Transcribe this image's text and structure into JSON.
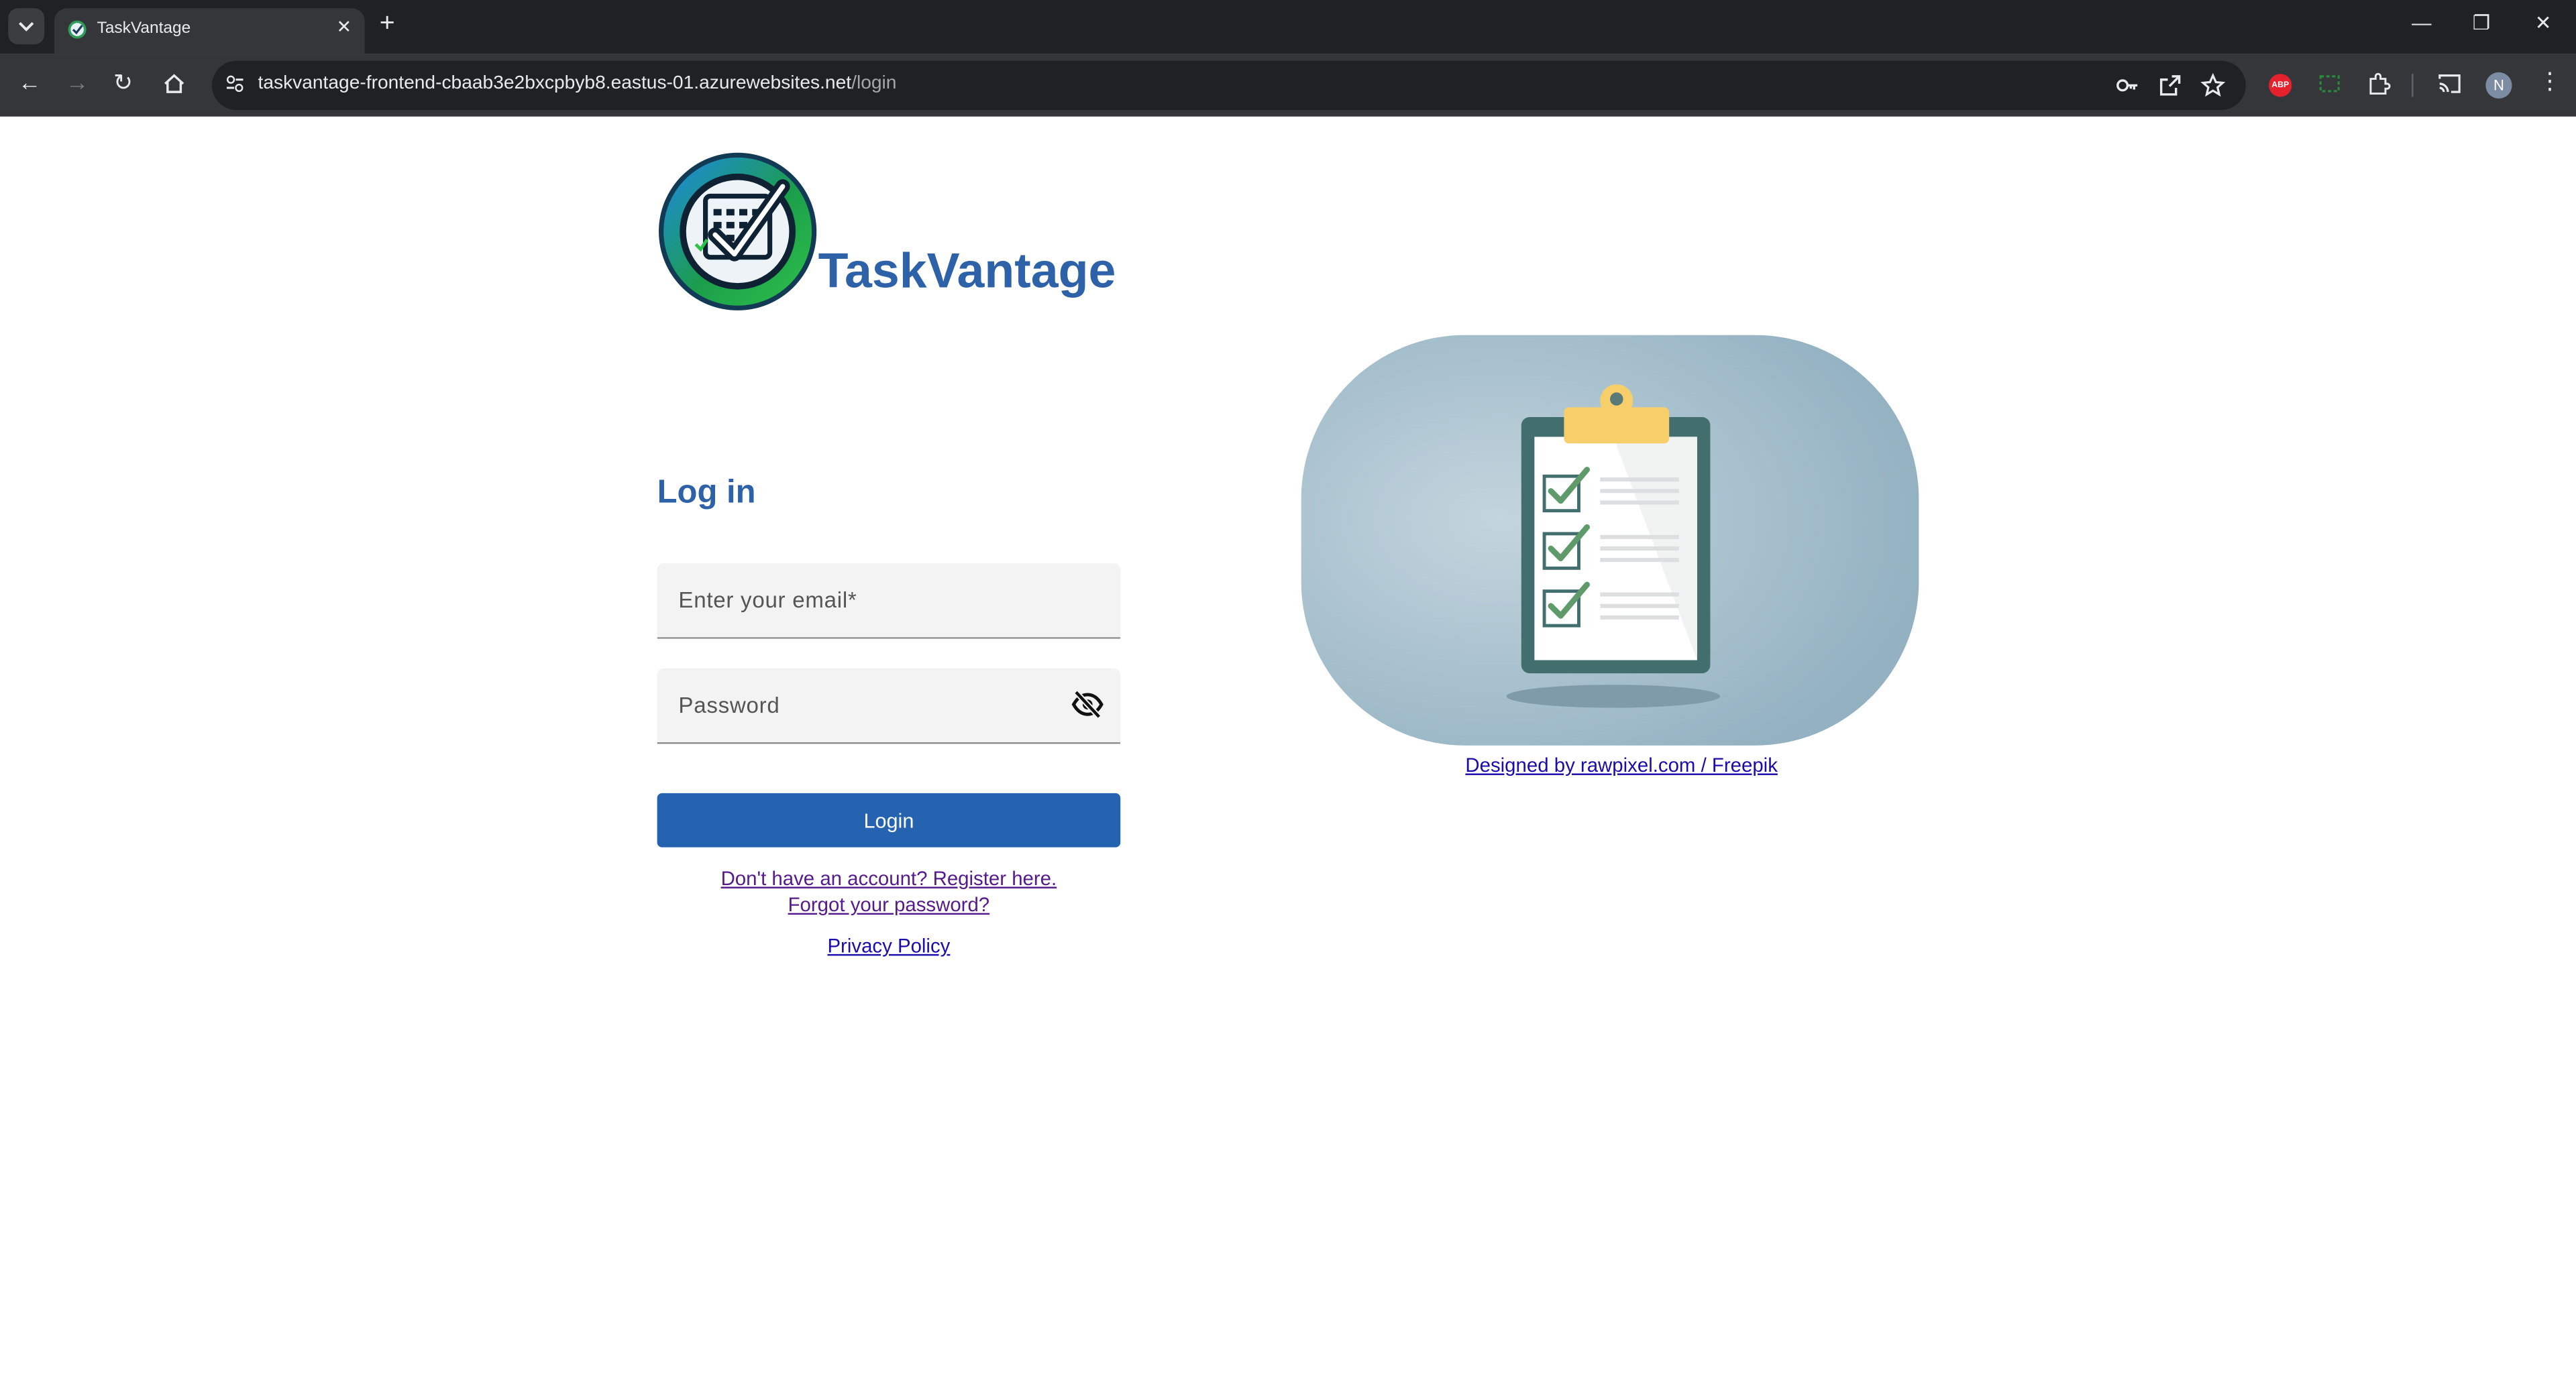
{
  "browser": {
    "tab_title": "TaskVantage",
    "url_host": "taskvantage-frontend-cbaab3e2bxcpbyb8.eastus-01.azurewebsites.net",
    "url_path": "/login",
    "profile_initial": "N",
    "abp_label": "ABP"
  },
  "brand": {
    "name": "TaskVantage"
  },
  "login": {
    "heading": "Log in",
    "email_placeholder": "Enter your email*",
    "password_placeholder": "Password",
    "submit_label": "Login",
    "register_link": "Don't have an account? Register here.",
    "forgot_link": "Forgot your password?",
    "privacy_link": "Privacy Policy"
  },
  "illustration": {
    "credit": "Designed by rawpixel.com / Freepik"
  },
  "colors": {
    "brand_blue": "#2e62a8",
    "button_blue": "#2563b0",
    "hero_bg": "#97b4c4",
    "clipboard": "#426e6e"
  }
}
